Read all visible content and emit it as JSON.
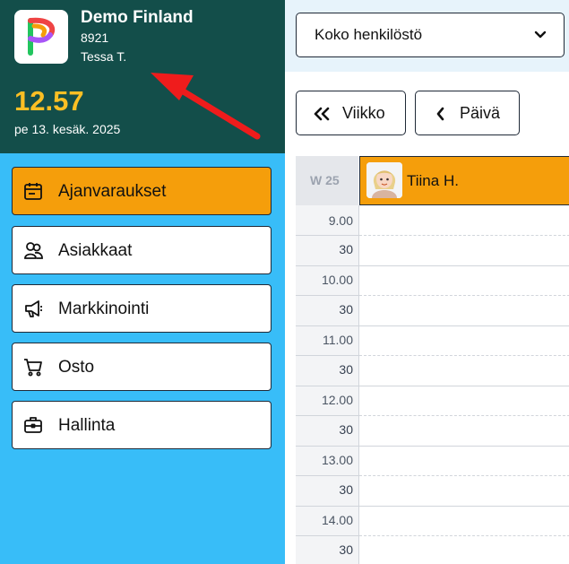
{
  "sidebar": {
    "company_name": "Demo Finland",
    "company_code": "8921",
    "user_name": "Tessa T.",
    "time": "12.57",
    "date": "pe 13. kesäk. 2025",
    "items": [
      {
        "label": "Ajanvaraukset",
        "icon": "calendar-icon",
        "active": true
      },
      {
        "label": "Asiakkaat",
        "icon": "users-icon",
        "active": false
      },
      {
        "label": "Markkinointi",
        "icon": "megaphone-icon",
        "active": false
      },
      {
        "label": "Osto",
        "icon": "cart-icon",
        "active": false
      },
      {
        "label": "Hallinta",
        "icon": "briefcase-icon",
        "active": false
      }
    ]
  },
  "toolbar": {
    "staff_select_value": "Koko henkilöstö",
    "week_button": "Viikko",
    "day_button": "Päivä"
  },
  "calendar": {
    "week_label": "W 25",
    "staff": [
      {
        "name": "Tiina H."
      }
    ],
    "slots": [
      "9.00",
      "30",
      "10.00",
      "30",
      "11.00",
      "30",
      "12.00",
      "30",
      "13.00",
      "30",
      "14.00",
      "30"
    ]
  },
  "colors": {
    "sidebar_bg": "#38bdf8",
    "profile_bg": "#134e4a",
    "accent": "#f59e0b",
    "time_text": "#fbbf24",
    "annotation_arrow": "#ef1c1c"
  }
}
